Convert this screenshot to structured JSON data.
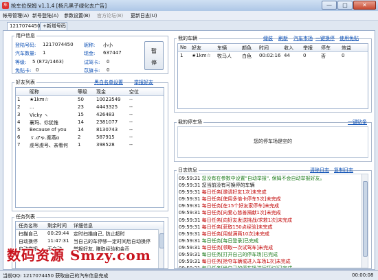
{
  "window": {
    "title": "抢车位保姆 v1.1.4 [杨凡黑子绿化去广告]",
    "buttons": [
      "—",
      "□",
      "✕"
    ]
  },
  "menu": [
    {
      "label": "帐号管理(A)",
      "enabled": true
    },
    {
      "label": "新号登陆(A)",
      "enabled": true
    },
    {
      "label": "参数设置(B)",
      "enabled": true
    },
    {
      "label": "官方论坛(B)",
      "enabled": false
    },
    {
      "label": "更新日志(U)",
      "enabled": true
    }
  ],
  "tabs": [
    {
      "label": "1217074450",
      "active": true
    },
    {
      "label": "+新增号码",
      "active": false
    }
  ],
  "user_info": {
    "section_title": "用户信息",
    "login_label": "登陆号码:",
    "login_value": "1217074450",
    "nick_label": "昵称:",
    "nick_value": "小小",
    "cars_label": "汽车数量:",
    "cars_value": "1",
    "cash_label": "现金:",
    "cash_value": "637447",
    "level_label": "等级:",
    "level_value": "5 (872/1463)",
    "trial_label": "试驾卡:",
    "trial_value": "0",
    "freepark_label": "免贴卡:",
    "freepark_value": "0",
    "flag_label": "苡旗卡:",
    "flag_value": "0",
    "pause_button": [
      "暂",
      "停"
    ]
  },
  "friends": {
    "section_title": "好友列表",
    "links": [
      "黑白名单设置",
      "举报好友"
    ],
    "columns": [
      "",
      "昵称",
      "等级",
      "现金",
      "空位"
    ],
    "rows": [
      [
        "1",
        "★1km☆",
        "50",
        "10023549",
        "--"
      ],
      [
        "2",
        "...",
        "23",
        "4443325",
        "--"
      ],
      [
        "3",
        "Vicky ヽ",
        "15",
        "426483",
        "--"
      ],
      [
        "4",
        "襄玛、伱犹惟",
        "14",
        "2381077",
        "--"
      ],
      [
        "5",
        "Because of you",
        "14",
        "8130743",
        "--"
      ],
      [
        "6",
        "ゞ.♂ゃ.秦燕α",
        "2",
        "587915",
        "--"
      ],
      [
        "7",
        "虔号虔号、亲看何",
        "1",
        "398528",
        "--"
      ]
    ]
  },
  "tasks": {
    "section_title": "任务列表",
    "columns": [
      "任务名称",
      "剩余时间",
      "详细信息"
    ],
    "rows": [
      [
        "扫描自己",
        "00:29:44",
        "定时扫描自己, 防止超时"
      ],
      [
        "自动换停",
        "11:47:31",
        "当自己的车停够一定时间后自动换停"
      ],
      [
        "自动举报",
        "无自动",
        "举报好友, 赚取经验和金币"
      ]
    ]
  },
  "my_cars": {
    "section_title": "我的车辆",
    "links": [
      "绿装",
      "刷新",
      "汽车市场",
      "一键换停",
      "使用免贴"
    ],
    "columns": [
      "No",
      "好友",
      "车辆",
      "颜色",
      "时间",
      "收入",
      "举报",
      "停车",
      "效益"
    ],
    "rows": [
      [
        "1",
        "★1km☆",
        "牧马人",
        "白色",
        "00:02:16",
        "44",
        "0",
        "否",
        "0"
      ]
    ]
  },
  "my_lot": {
    "section_title": "我的停车场",
    "link": "一键贴条",
    "empty_text": "您的停车场是空的"
  },
  "log": {
    "section_title": "日志信息",
    "links": [
      "清除日志",
      "复制日志"
    ],
    "lines": [
      {
        "time": "09:59:31",
        "text": "您没有在参数中设置\"自动举报\", 保姆不会自动举报好友。",
        "color": "#1a7a1a"
      },
      {
        "time": "09:59:31",
        "text": "您当前没有可换停的车辆",
        "color": "#111111"
      },
      {
        "time": "09:59:31",
        "text": "每日任务[邀请好友1次]未完成",
        "color": "#c00000"
      },
      {
        "time": "09:59:31",
        "text": "每日任务[使用多倍卡停车5次]未完成",
        "color": "#c00000"
      },
      {
        "time": "09:59:31",
        "text": "每日任务[在15个好友家停车]未完成",
        "color": "#c00000"
      },
      {
        "time": "09:59:31",
        "text": "每日任务[向爱心慈善捐献1次]未完成",
        "color": "#c00000"
      },
      {
        "time": "09:59:31",
        "text": "每日任务[向好友发送挑战/求救1次]未完成",
        "color": "#c00000"
      },
      {
        "time": "09:59:31",
        "text": "每日任务[获取150点经验]未完成",
        "color": "#c00000"
      },
      {
        "time": "09:59:31",
        "text": "每日任务[用就满两10次]未完成",
        "color": "#c00000"
      },
      {
        "time": "09:59:31",
        "text": "每日任务[每日登录]已完成",
        "color": "#1a7a1a"
      },
      {
        "time": "09:59:31",
        "text": "每日任务[领取一次试驾车]未完成",
        "color": "#c00000"
      },
      {
        "time": "09:59:31",
        "text": "每日任务[打开自己的停车场]已完成",
        "color": "#1a7a1a"
      },
      {
        "time": "09:59:31",
        "text": "每日任务[抢夺车辆或进入车场1次]未完成",
        "color": "#c00000"
      },
      {
        "time": "09:59:31",
        "text": "每日任务[给自己的停车场进行打扫]已完成",
        "color": "#1a7a1a"
      }
    ]
  },
  "status_bar": {
    "left": "当前QQ: 1217074450  获取自己的汽车信息完成",
    "right": "00:00:08"
  },
  "watermark": "数码资源 Smzy.com"
}
